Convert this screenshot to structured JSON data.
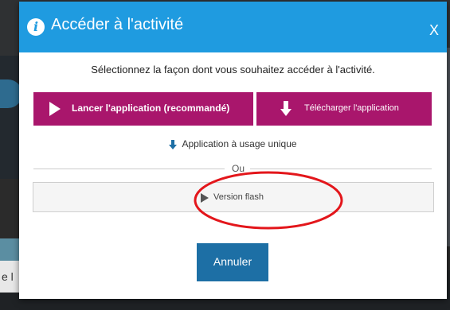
{
  "dialog": {
    "title": "Accéder à l'activité",
    "close_label": "X",
    "prompt": "Sélectionnez la façon dont vous souhaitez accéder à l'activité.",
    "launch_app_label": "Lancer l'application (recommandé)",
    "download_app_label": "Télécharger l'application",
    "single_use_label": "Application à usage unique",
    "or_label": "Ou",
    "flash_version_label": "Version flash",
    "cancel_label": "Annuler"
  },
  "background": {
    "partial_text": "e l"
  },
  "colors": {
    "header": "#1f9be0",
    "primary_buttons": "#a9166c",
    "cancel_button": "#1d6fa5",
    "highlight_ellipse": "#e3161b"
  },
  "icons": {
    "header": "info-icon",
    "launch": "play-icon",
    "download": "download-arrow-icon",
    "single_use": "download-arrow-icon",
    "flash": "play-icon"
  }
}
